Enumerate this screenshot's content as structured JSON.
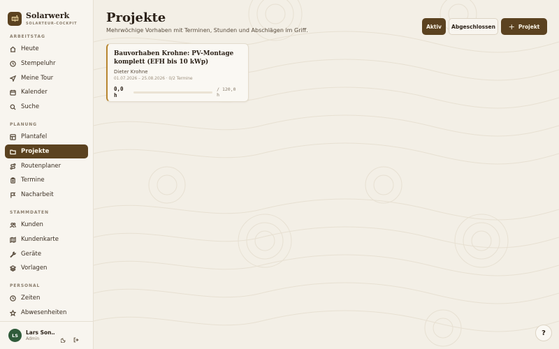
{
  "brand": {
    "name": "Solarwerk",
    "subtitle": "SOLARTEUR-COCKPIT",
    "icon": "solar-panel-icon"
  },
  "sidebar": {
    "sections": [
      {
        "title": "ARBEITSTAG",
        "items": [
          {
            "label": "Heute",
            "icon": "home-icon"
          },
          {
            "label": "Stempeluhr",
            "icon": "clock-icon"
          },
          {
            "label": "Meine Tour",
            "icon": "navigation-icon"
          },
          {
            "label": "Kalender",
            "icon": "calendar-icon"
          },
          {
            "label": "Suche",
            "icon": "search-icon"
          }
        ]
      },
      {
        "title": "PLANUNG",
        "items": [
          {
            "label": "Plantafel",
            "icon": "grid-icon"
          },
          {
            "label": "Projekte",
            "icon": "folder-icon",
            "active": true
          },
          {
            "label": "Routenplaner",
            "icon": "route-icon"
          },
          {
            "label": "Termine",
            "icon": "clipboard-icon"
          },
          {
            "label": "Nacharbeit",
            "icon": "flag-icon"
          }
        ]
      },
      {
        "title": "STAMMDATEN",
        "items": [
          {
            "label": "Kunden",
            "icon": "users-icon"
          },
          {
            "label": "Kundenkarte",
            "icon": "map-icon"
          },
          {
            "label": "Geräte",
            "icon": "wrench-icon"
          },
          {
            "label": "Vorlagen",
            "icon": "layers-icon"
          }
        ]
      },
      {
        "title": "PERSONAL",
        "items": [
          {
            "label": "Zeiten",
            "icon": "clock-icon"
          },
          {
            "label": "Abwesenheiten",
            "icon": "star-icon"
          }
        ]
      }
    ]
  },
  "user": {
    "initials": "LS",
    "name": "Lars Son…",
    "role": "Admin"
  },
  "page": {
    "title": "Projekte",
    "subtitle": "Mehrwöchige Vorhaben mit Terminen, Stunden und Abschlägen im Griff."
  },
  "filters": {
    "active_label": "Aktiv",
    "closed_label": "Abgeschlossen",
    "selected": "Aktiv"
  },
  "actions": {
    "new_project_label": "Projekt"
  },
  "projects": [
    {
      "title": "Bauvorhaben Krohne: PV-Montage komplett (EFH bis 10 kWp)",
      "customer": "Dieter Krohne",
      "meta": "01.07.2026 – 25.08.2026 · 0/2 Termine",
      "hours_done": "0,0 h",
      "hours_total": "/ 120,0 h",
      "progress_fraction": 0
    }
  ],
  "help": {
    "label": "?"
  },
  "colors": {
    "accent": "#5b4220",
    "gold": "#b8862f",
    "background": "#f3efe6",
    "avatar": "#2f5b3a"
  }
}
